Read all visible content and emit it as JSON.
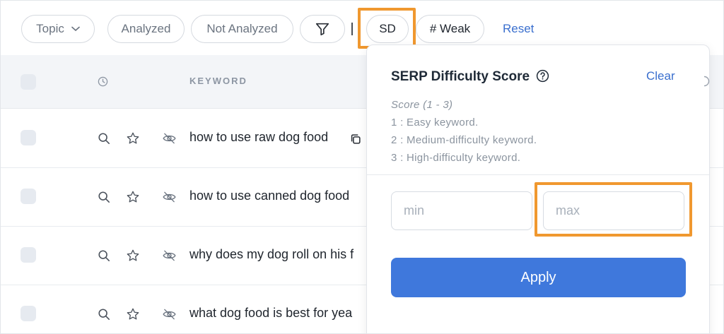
{
  "toolbar": {
    "topic_label": "Topic",
    "analyzed_label": "Analyzed",
    "not_analyzed_label": "Not Analyzed",
    "sd_label": "SD",
    "weak_label": "# Weak",
    "reset_label": "Reset"
  },
  "table": {
    "keyword_header": "KEYWORD",
    "rows": [
      {
        "keyword": "how to use raw dog food"
      },
      {
        "keyword": "how to use canned dog food"
      },
      {
        "keyword": "why does my dog roll on his f"
      },
      {
        "keyword": "what dog food is best for yea"
      }
    ]
  },
  "popover": {
    "title": "SERP Difficulty Score",
    "clear_label": "Clear",
    "score_range": "Score (1 - 3)",
    "levels": [
      "1 : Easy keyword.",
      "2 : Medium-difficulty keyword.",
      "3 : High-difficulty keyword."
    ],
    "min_placeholder": "min",
    "max_placeholder": "max",
    "apply_label": "Apply"
  },
  "colors": {
    "accent": "#3f78dc",
    "highlight": "#f0982f",
    "link": "#3a6fce"
  }
}
